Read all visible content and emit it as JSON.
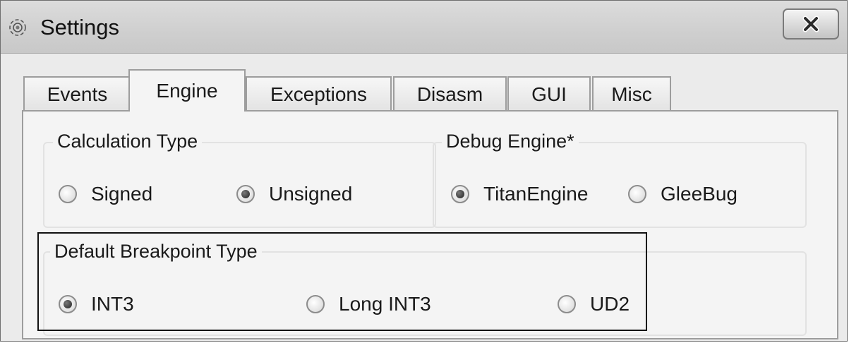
{
  "window": {
    "title": "Settings",
    "close_label": "X"
  },
  "tabs": [
    {
      "label": "Events"
    },
    {
      "label": "Engine",
      "active": true
    },
    {
      "label": "Exceptions"
    },
    {
      "label": "Disasm"
    },
    {
      "label": "GUI"
    },
    {
      "label": "Misc"
    }
  ],
  "calculation_type": {
    "title": "Calculation Type",
    "options": [
      {
        "label": "Signed",
        "checked": false
      },
      {
        "label": "Unsigned",
        "checked": true
      }
    ]
  },
  "debug_engine": {
    "title": "Debug Engine*",
    "options": [
      {
        "label": "TitanEngine",
        "checked": true
      },
      {
        "label": "GleeBug",
        "checked": false
      }
    ]
  },
  "default_breakpoint_type": {
    "title": "Default Breakpoint Type",
    "options": [
      {
        "label": "INT3",
        "checked": true
      },
      {
        "label": "Long INT3",
        "checked": false
      },
      {
        "label": "UD2",
        "checked": false
      }
    ]
  }
}
